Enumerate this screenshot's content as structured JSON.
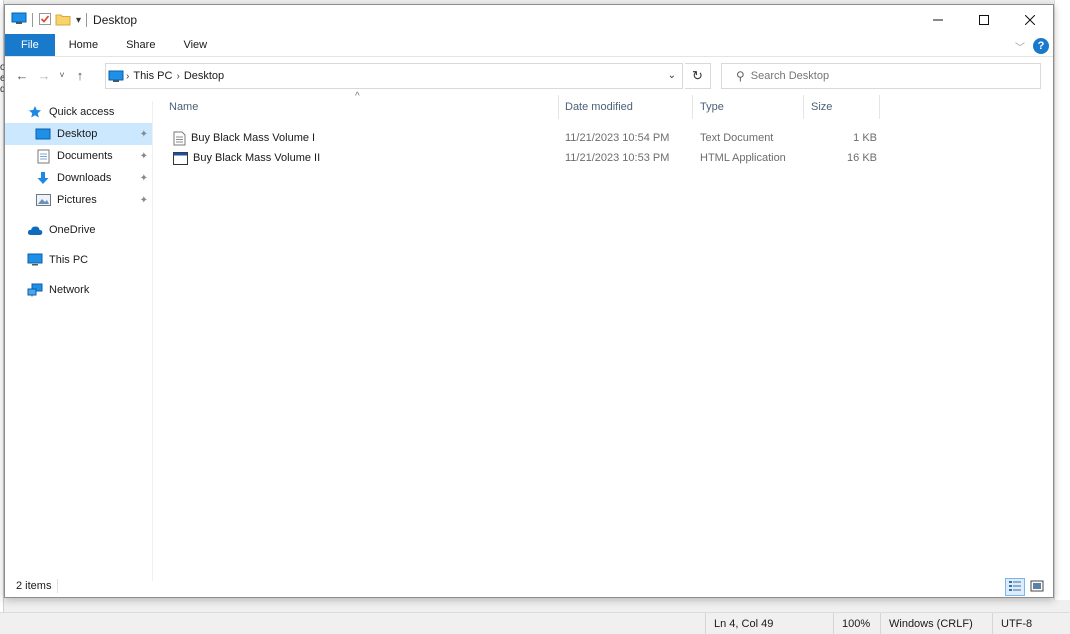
{
  "background_app": {
    "status": {
      "cursor": "Ln 4, Col 49",
      "zoom": "100%",
      "line_endings": "Windows (CRLF)",
      "encoding": "UTF-8"
    }
  },
  "window": {
    "title": "Desktop"
  },
  "ribbon": {
    "tabs": [
      "File",
      "Home",
      "Share",
      "View"
    ]
  },
  "address": {
    "crumbs": [
      "This PC",
      "Desktop"
    ]
  },
  "search": {
    "placeholder": "Search Desktop"
  },
  "sidebar": {
    "items": [
      {
        "label": "Quick access",
        "icon": "star-icon"
      },
      {
        "label": "Desktop",
        "icon": "desktop-icon",
        "pinned": true,
        "selected": true
      },
      {
        "label": "Documents",
        "icon": "documents-icon",
        "pinned": true
      },
      {
        "label": "Downloads",
        "icon": "downloads-icon",
        "pinned": true
      },
      {
        "label": "Pictures",
        "icon": "pictures-icon",
        "pinned": true
      },
      {
        "label": "OneDrive",
        "icon": "cloud-icon"
      },
      {
        "label": "This PC",
        "icon": "computer-icon"
      },
      {
        "label": "Network",
        "icon": "network-icon"
      }
    ]
  },
  "columns": {
    "name": "Name",
    "date": "Date modified",
    "type": "Type",
    "size": "Size"
  },
  "files": [
    {
      "name": "Buy Black Mass Volume I",
      "date": "11/21/2023 10:54 PM",
      "type": "Text Document",
      "size": "1 KB",
      "icon": "text-file-icon"
    },
    {
      "name": "Buy Black Mass Volume II",
      "date": "11/21/2023 10:53 PM",
      "type": "HTML Application",
      "size": "16 KB",
      "icon": "hta-file-icon"
    }
  ],
  "status": {
    "item_count": "2 items"
  },
  "colors": {
    "accent": "#1979ca",
    "selection": "#cce8ff"
  }
}
